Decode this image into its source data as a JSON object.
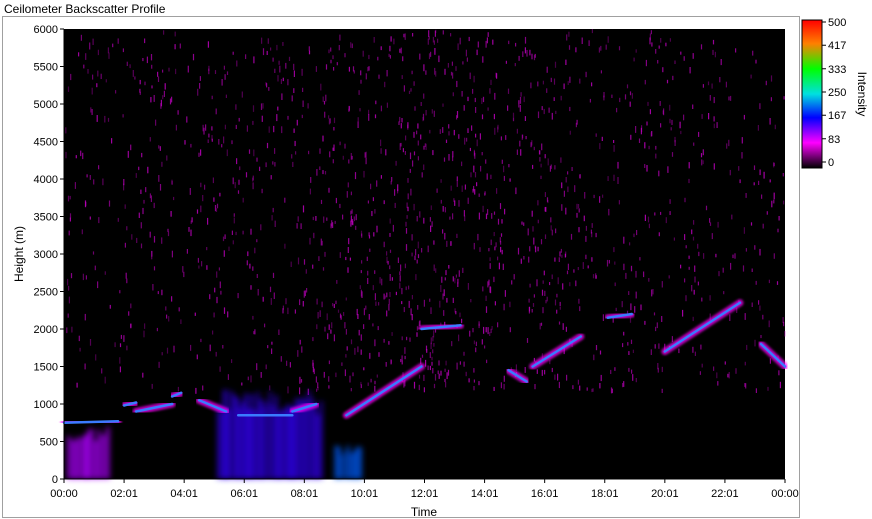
{
  "window": {
    "title": "Ceilometer Backscatter Profile"
  },
  "chart_data": {
    "type": "heatmap",
    "title": "",
    "xlabel": "Time",
    "ylabel": "Height (m)",
    "x_tick_labels": [
      "00:00",
      "02:01",
      "04:01",
      "06:01",
      "08:01",
      "10:01",
      "12:01",
      "14:01",
      "16:01",
      "18:01",
      "20:01",
      "22:01",
      "00:00"
    ],
    "ylim": [
      0,
      6000
    ],
    "y_ticks": [
      0,
      500,
      1000,
      1500,
      2000,
      2500,
      3000,
      3500,
      4000,
      4500,
      5000,
      5500,
      6000
    ],
    "colorbar": {
      "label": "Intensity",
      "range": [
        0,
        500
      ],
      "tick_labels": [
        "500",
        "417",
        "333",
        "250",
        "167",
        "83",
        "0"
      ],
      "tick_values": [
        500,
        417,
        333,
        250,
        167,
        83,
        0
      ],
      "colors": [
        "#ff0000",
        "#ff8000",
        "#00ff00",
        "#00e0e0",
        "#0000ff",
        "#ff00ff",
        "#000000"
      ]
    },
    "cloud_base_segments": [
      {
        "t_start": 0.0,
        "t_end": 1.8,
        "height_start": 750,
        "height_end": 770
      },
      {
        "t_start": 2.0,
        "t_end": 2.4,
        "height_start": 980,
        "height_end": 1020
      },
      {
        "t_start": 2.4,
        "t_end": 3.6,
        "height_start": 900,
        "height_end": 1000
      },
      {
        "t_start": 3.6,
        "t_end": 3.9,
        "height_start": 1100,
        "height_end": 1150
      },
      {
        "t_start": 4.5,
        "t_end": 5.4,
        "height_start": 1050,
        "height_end": 900
      },
      {
        "t_start": 5.8,
        "t_end": 7.6,
        "height_start": 850,
        "height_end": 850
      },
      {
        "t_start": 7.6,
        "t_end": 8.4,
        "height_start": 900,
        "height_end": 1000
      },
      {
        "t_start": 9.4,
        "t_end": 11.9,
        "height_start": 850,
        "height_end": 1500
      },
      {
        "t_start": 11.9,
        "t_end": 13.2,
        "height_start": 2000,
        "height_end": 2050
      },
      {
        "t_start": 14.8,
        "t_end": 15.4,
        "height_start": 1450,
        "height_end": 1300
      },
      {
        "t_start": 15.6,
        "t_end": 17.2,
        "height_start": 1500,
        "height_end": 1900
      },
      {
        "t_start": 18.1,
        "t_end": 18.9,
        "height_start": 2150,
        "height_end": 2200
      },
      {
        "t_start": 20.0,
        "t_end": 22.5,
        "height_start": 1700,
        "height_end": 2350
      },
      {
        "t_start": 23.2,
        "t_end": 24.0,
        "height_start": 1800,
        "height_end": 1500
      }
    ],
    "low_scatter_regions": [
      {
        "t_start": 0.1,
        "t_end": 1.5,
        "height_top": 700,
        "intensity": 110
      },
      {
        "t_start": 5.1,
        "t_end": 8.6,
        "height_top": 1200,
        "intensity": 150
      },
      {
        "t_start": 9.0,
        "t_end": 9.9,
        "height_top": 450,
        "intensity": 200
      }
    ]
  }
}
